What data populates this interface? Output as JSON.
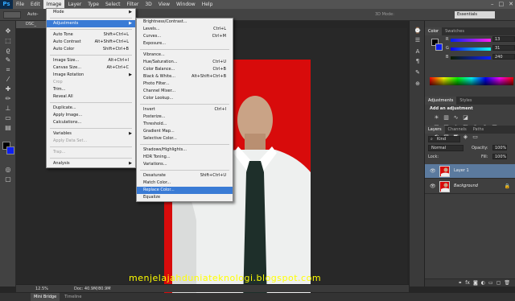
{
  "app": {
    "logo": "Ps"
  },
  "menubar": {
    "items": [
      "File",
      "Edit",
      "Image",
      "Layer",
      "Type",
      "Select",
      "Filter",
      "3D",
      "View",
      "Window",
      "Help"
    ],
    "active": "Image",
    "window_controls": [
      "–",
      "□",
      "✕"
    ]
  },
  "options": {
    "auto_select": "Auto-",
    "mode_3d": "3D Mode:",
    "workspace": "Essentials"
  },
  "document": {
    "tab_label": "DSC_"
  },
  "image_menu": [
    {
      "label": "Mode",
      "submenu": true
    },
    {
      "sep": true
    },
    {
      "label": "Adjustments",
      "submenu": true,
      "highlighted": true
    },
    {
      "sep": true
    },
    {
      "label": "Auto Tone",
      "shortcut": "Shift+Ctrl+L"
    },
    {
      "label": "Auto Contrast",
      "shortcut": "Alt+Shift+Ctrl+L"
    },
    {
      "label": "Auto Color",
      "shortcut": "Shift+Ctrl+B"
    },
    {
      "sep": true
    },
    {
      "label": "Image Size...",
      "shortcut": "Alt+Ctrl+I"
    },
    {
      "label": "Canvas Size...",
      "shortcut": "Alt+Ctrl+C"
    },
    {
      "label": "Image Rotation",
      "submenu": true
    },
    {
      "label": "Crop",
      "disabled": true
    },
    {
      "label": "Trim..."
    },
    {
      "label": "Reveal All"
    },
    {
      "sep": true
    },
    {
      "label": "Duplicate..."
    },
    {
      "label": "Apply Image..."
    },
    {
      "label": "Calculations..."
    },
    {
      "sep": true
    },
    {
      "label": "Variables",
      "submenu": true
    },
    {
      "label": "Apply Data Set...",
      "disabled": true
    },
    {
      "sep": true
    },
    {
      "label": "Trap...",
      "disabled": true
    },
    {
      "sep": true
    },
    {
      "label": "Analysis",
      "submenu": true
    }
  ],
  "adjustments_menu": [
    {
      "label": "Brightness/Contrast..."
    },
    {
      "label": "Levels...",
      "shortcut": "Ctrl+L"
    },
    {
      "label": "Curves...",
      "shortcut": "Ctrl+M"
    },
    {
      "label": "Exposure..."
    },
    {
      "sep": true
    },
    {
      "label": "Vibrance..."
    },
    {
      "label": "Hue/Saturation...",
      "shortcut": "Ctrl+U"
    },
    {
      "label": "Color Balance...",
      "shortcut": "Ctrl+B"
    },
    {
      "label": "Black & White...",
      "shortcut": "Alt+Shift+Ctrl+B"
    },
    {
      "label": "Photo Filter..."
    },
    {
      "label": "Channel Mixer..."
    },
    {
      "label": "Color Lookup..."
    },
    {
      "sep": true
    },
    {
      "label": "Invert",
      "shortcut": "Ctrl+I"
    },
    {
      "label": "Posterize..."
    },
    {
      "label": "Threshold..."
    },
    {
      "label": "Gradient Map..."
    },
    {
      "label": "Selective Color..."
    },
    {
      "sep": true
    },
    {
      "label": "Shadows/Highlights..."
    },
    {
      "label": "HDR Toning..."
    },
    {
      "label": "Variations..."
    },
    {
      "sep": true
    },
    {
      "label": "Desaturate",
      "shortcut": "Shift+Ctrl+U"
    },
    {
      "label": "Match Color..."
    },
    {
      "label": "Replace Color...",
      "highlighted": true
    },
    {
      "label": "Equalize"
    }
  ],
  "color_panel": {
    "tabs": [
      "Color",
      "Swatches"
    ],
    "rows": [
      {
        "label": "R",
        "value": "13"
      },
      {
        "label": "G",
        "value": "31"
      },
      {
        "label": "B",
        "value": "240"
      }
    ],
    "foreground_color": "#000000",
    "background_color": "#0d1ff0"
  },
  "adjustments_panel": {
    "tabs": [
      "Adjustments",
      "Styles"
    ],
    "heading": "Add an adjustment"
  },
  "layers_panel": {
    "tabs": [
      "Layers",
      "Channels",
      "Paths"
    ],
    "filter": "Kind",
    "blend_mode": "Normal",
    "opacity_label": "Opacity:",
    "opacity": "100%",
    "lock_label": "Lock:",
    "fill_label": "Fill:",
    "fill": "100%",
    "layers": [
      {
        "name": "Layer 1",
        "selected": true
      },
      {
        "name": "Background",
        "selected": false
      }
    ]
  },
  "status": {
    "zoom": "12.5%",
    "doc": "Doc: 40.9M/80.9M"
  },
  "bottom_tabs": [
    "Mini Bridge",
    "Timeline"
  ],
  "watermark": "menjelajahduniateknologi.blogspot.com"
}
